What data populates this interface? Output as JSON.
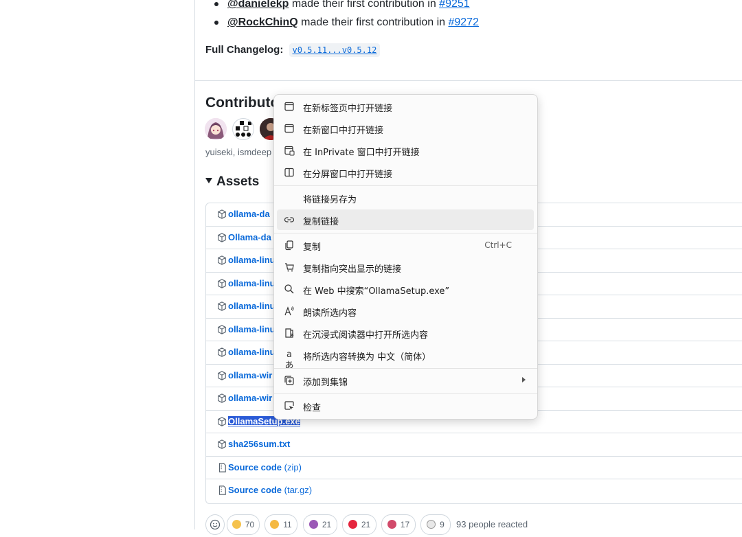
{
  "contributions": [
    {
      "user": "@danielekp",
      "text": " made their first contribution in ",
      "pr": "#9251"
    },
    {
      "user": "@RockChinQ",
      "text": " made their first contribution in ",
      "pr": "#9272"
    }
  ],
  "changelog": {
    "label": "Full Changelog:",
    "compare": "v0.5.11...v0.5.12"
  },
  "contributors": {
    "title": "Contributors",
    "names": "yuiseki, ismdeep"
  },
  "assets": {
    "title": "Assets",
    "items": [
      {
        "name": "ollama-da",
        "suffix": ""
      },
      {
        "name": "Ollama-da",
        "suffix": ""
      },
      {
        "name": "ollama-linu",
        "suffix": ""
      },
      {
        "name": "ollama-linu",
        "suffix": ""
      },
      {
        "name": "ollama-linu",
        "suffix": ""
      },
      {
        "name": "ollama-linu",
        "suffix": ""
      },
      {
        "name": "ollama-linu",
        "suffix": ""
      },
      {
        "name": "ollama-wir",
        "suffix": ""
      },
      {
        "name": "ollama-wir",
        "suffix": ""
      },
      {
        "name": "OllamaSetup.exe",
        "suffix": ""
      },
      {
        "name": "sha256sum.txt",
        "suffix": ""
      },
      {
        "name": "Source code",
        "suffix": " (zip)"
      },
      {
        "name": "Source code",
        "suffix": " (tar.gz)"
      }
    ]
  },
  "reactions": {
    "items": [
      {
        "emoji": "thumbs-up",
        "count": "70"
      },
      {
        "emoji": "laugh",
        "count": "11"
      },
      {
        "emoji": "hooray",
        "count": "21"
      },
      {
        "emoji": "heart",
        "count": "21"
      },
      {
        "emoji": "rocket",
        "count": "17"
      },
      {
        "emoji": "eyes",
        "count": "9"
      }
    ],
    "summary": "93 people reacted"
  },
  "context_menu": {
    "items": [
      {
        "icon": "new-tab-icon",
        "label": "在新标签页中打开链接"
      },
      {
        "icon": "new-window-icon",
        "label": "在新窗口中打开链接"
      },
      {
        "icon": "inprivate-window-icon",
        "label": "在 InPrivate 窗口中打开链接"
      },
      {
        "icon": "split-screen-icon",
        "label": "在分屏窗口中打开链接"
      },
      {
        "icon": "",
        "label": "将链接另存为"
      },
      {
        "icon": "link-icon",
        "label": "复制链接"
      },
      {
        "icon": "copy-icon",
        "label": "复制",
        "shortcut": "Ctrl+C"
      },
      {
        "icon": "copy-highlight-link-icon",
        "label": "复制指向突出显示的链接"
      },
      {
        "icon": "search-icon",
        "label": "在 Web 中搜索“OllamaSetup.exe”"
      },
      {
        "icon": "read-aloud-icon",
        "label": "朗读所选内容"
      },
      {
        "icon": "immersive-reader-icon",
        "label": "在沉浸式阅读器中打开所选内容"
      },
      {
        "icon": "translate-icon",
        "label": "将所选内容转换为 中文（简体）"
      },
      {
        "icon": "collections-icon",
        "label": "添加到集锦"
      },
      {
        "icon": "inspect-icon",
        "label": "检查"
      }
    ]
  }
}
